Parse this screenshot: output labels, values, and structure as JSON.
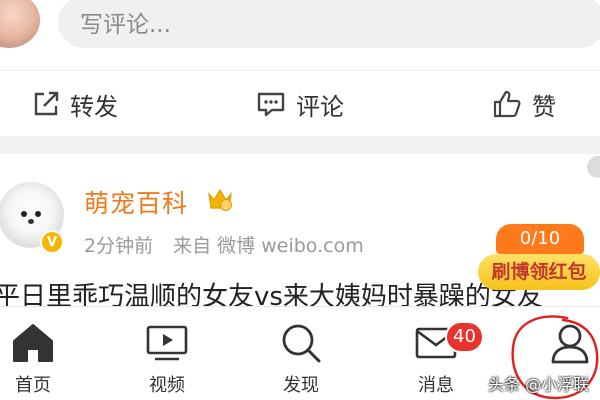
{
  "comment_bar": {
    "placeholder": "写评论..."
  },
  "actions": {
    "repost_label": "转发",
    "comment_label": "评论",
    "like_label": "赞"
  },
  "post": {
    "author": "萌宠百科",
    "time": "2分钟前",
    "source": "来自 微博 weibo.com",
    "verified_badge": "V",
    "text": "平日里乖巧温顺的女友vs来大姨妈时暴躁的女友"
  },
  "red_packet": {
    "count": "0/10",
    "label": "刷博领红包"
  },
  "tabs": [
    {
      "label": "首页",
      "icon": "home-icon"
    },
    {
      "label": "视频",
      "icon": "video-icon"
    },
    {
      "label": "发现",
      "icon": "search-icon"
    },
    {
      "label": "消息",
      "icon": "mail-icon",
      "badge": "40"
    },
    {
      "label": "",
      "icon": "user-icon"
    }
  ],
  "watermark": "头条 @小浮联",
  "colors": {
    "author": "#f07a1f",
    "badge_red": "#e8322e",
    "annotation_red": "#e0201c",
    "red_packet_orange": "#ff7a1a",
    "red_packet_yellow": "#f6c21c"
  }
}
